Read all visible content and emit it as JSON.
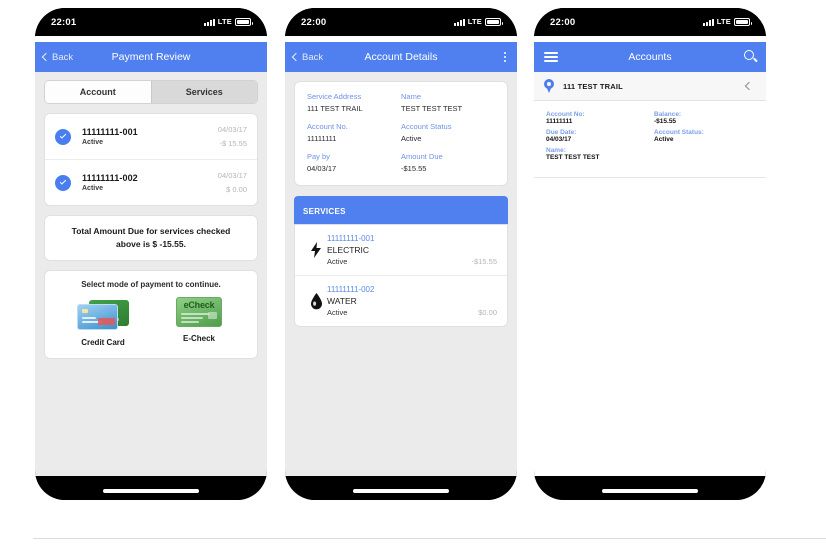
{
  "phones": [
    {
      "status": {
        "time": "22:01",
        "carrier": "LTE"
      },
      "nav": {
        "back": "Back",
        "title": "Payment Review"
      },
      "segmented": {
        "active": "Account",
        "inactive": "Services"
      },
      "accounts": [
        {
          "number": "11111111-001",
          "status": "Active",
          "date": "04/03/17",
          "amount": "-$ 15.55"
        },
        {
          "number": "11111111-002",
          "status": "Active",
          "date": "04/03/17",
          "amount": "$ 0.00"
        }
      ],
      "total_text": "Total Amount Due for services checked above is $ -15.55.",
      "payment": {
        "title": "Select mode of payment to continue.",
        "options": [
          {
            "label": "Credit Card",
            "icon": "credit-card-icon"
          },
          {
            "label": "E-Check",
            "icon": "echeck-icon",
            "badge": "eCheck"
          }
        ]
      }
    },
    {
      "status": {
        "time": "22:00",
        "carrier": "LTE"
      },
      "nav": {
        "back": "Back",
        "title": "Account Details",
        "menu_icon": "kebab-menu-icon"
      },
      "details": [
        {
          "label": "Service Address",
          "value": "111 TEST TRAIL"
        },
        {
          "label": "Name",
          "value": "TEST TEST TEST"
        },
        {
          "label": "Account No.",
          "value": "11111111"
        },
        {
          "label": "Account Status",
          "value": "Active"
        },
        {
          "label": "Pay by",
          "value": "04/03/17"
        },
        {
          "label": "Amount Due",
          "value": "-$15.55"
        }
      ],
      "services_header": "SERVICES",
      "services": [
        {
          "number": "11111111-001",
          "name": "ELECTRIC",
          "status": "Active",
          "amount": "-$15.55",
          "icon": "bolt-icon"
        },
        {
          "number": "11111111-002",
          "name": "WATER",
          "status": "Active",
          "amount": "$0.00",
          "icon": "water-drop-icon"
        }
      ]
    },
    {
      "status": {
        "time": "22:00",
        "carrier": "LTE"
      },
      "nav": {
        "title": "Accounts",
        "menu_icon": "hamburger-menu-icon",
        "search_icon": "search-icon"
      },
      "location": {
        "text": "111 TEST TRAIL",
        "icon": "map-pin-icon",
        "collapse_icon": "chevron-left-icon"
      },
      "account_card": [
        {
          "label": "Account No:",
          "value": "11111111"
        },
        {
          "label": "Balance:",
          "value": "-$15.55"
        },
        {
          "label": "Due Date:",
          "value": "04/03/17"
        },
        {
          "label": "Account Status:",
          "value": "Active"
        },
        {
          "label": "Name:",
          "value": "TEST TEST TEST"
        }
      ]
    }
  ],
  "colors": {
    "accent_blue": "#5080ef",
    "label_blue": "#6e93e8",
    "screen_bg": "#ebebeb",
    "muted": "#b5b5b5"
  }
}
